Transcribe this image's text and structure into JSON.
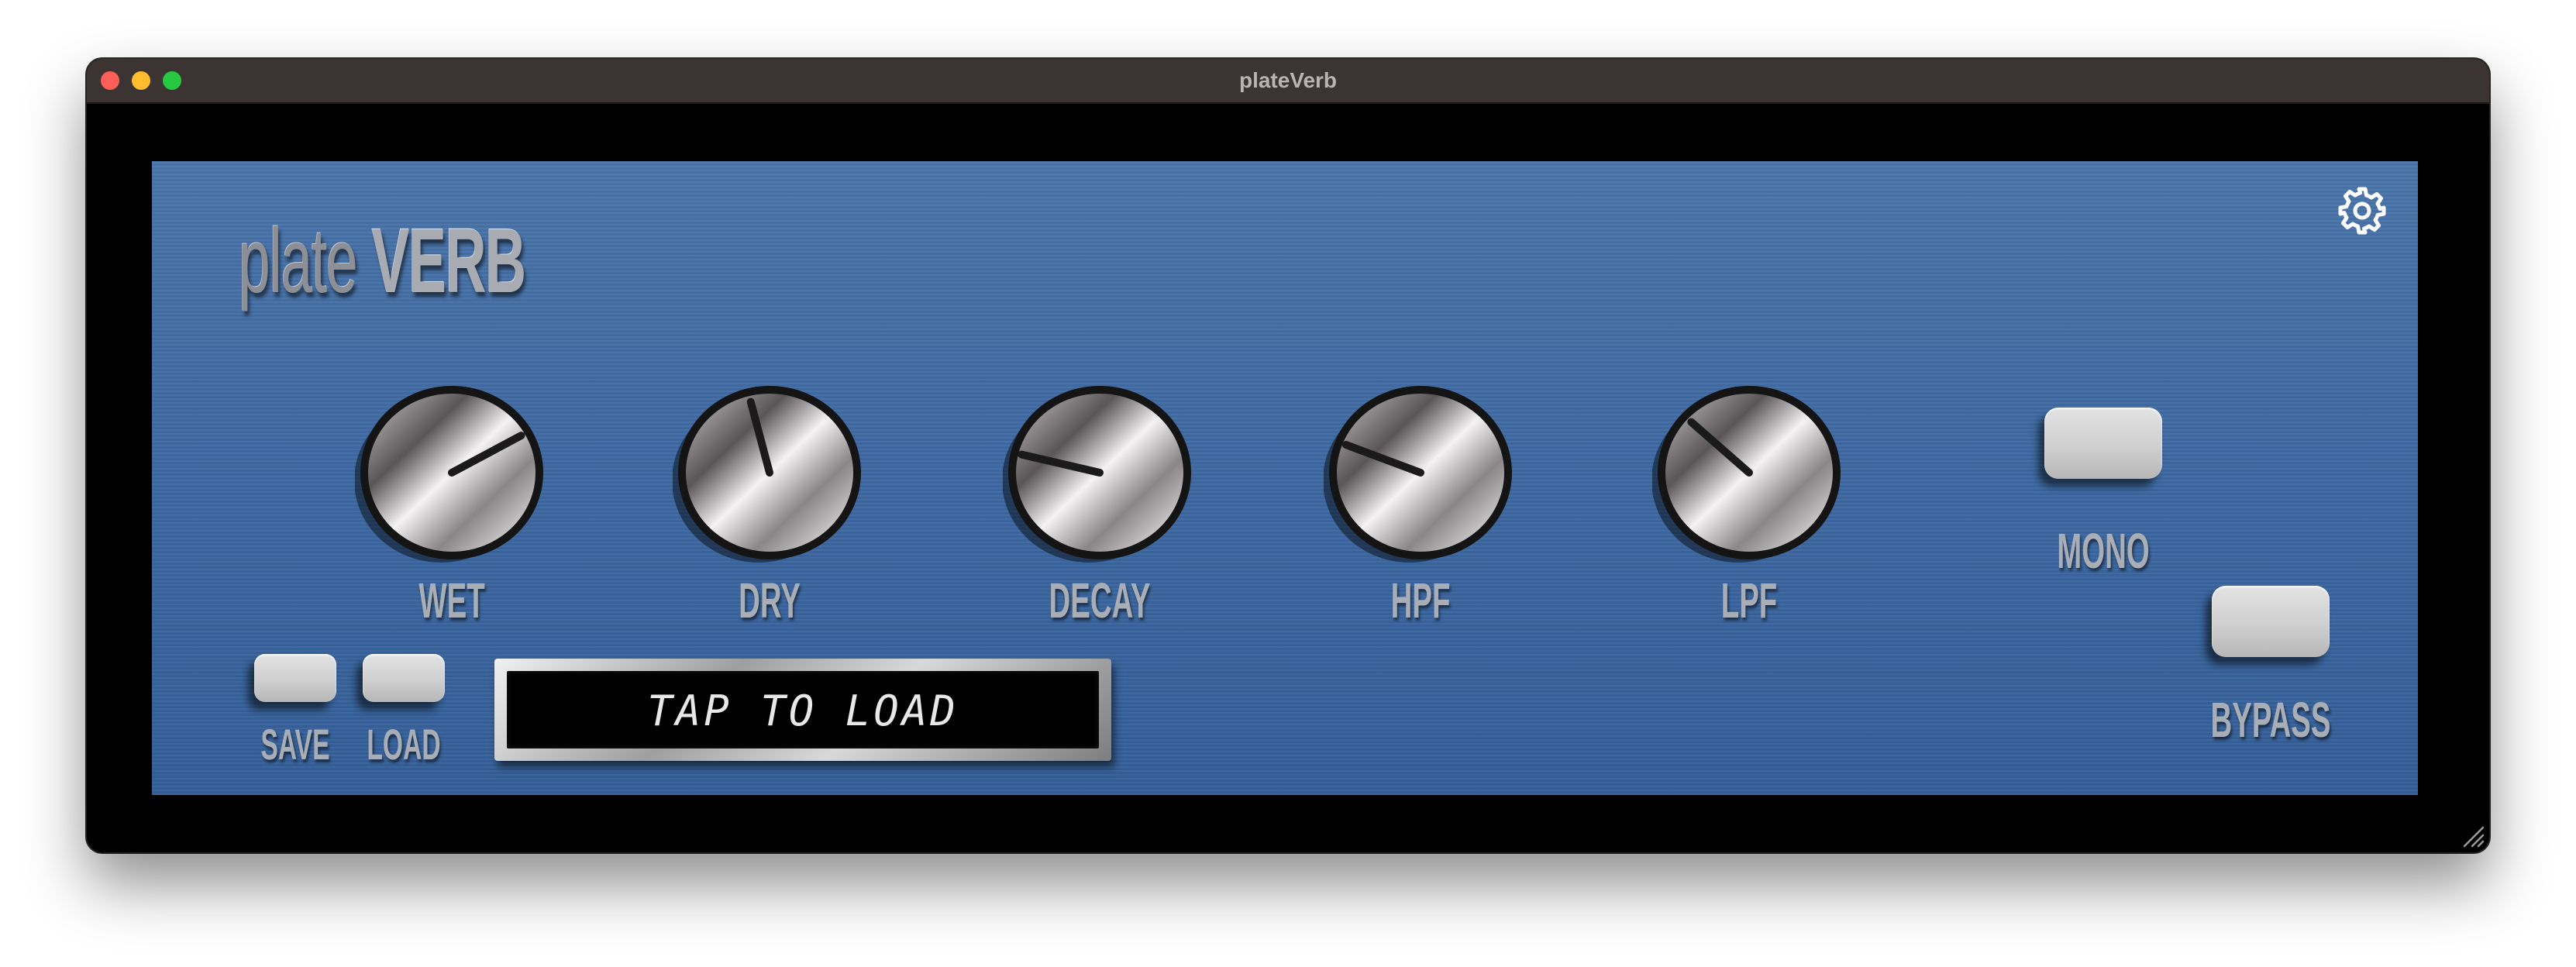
{
  "window": {
    "title": "plateVerb"
  },
  "logo": {
    "plate": "plate",
    "verb": "VERB"
  },
  "icons": {
    "settings": "gear-icon",
    "resize": "resize-grip-icon"
  },
  "knobs": [
    {
      "label": "WET",
      "value": 0.72
    },
    {
      "label": "DRY",
      "value": 0.45
    },
    {
      "label": "DECAY",
      "value": 0.22
    },
    {
      "label": "HPF",
      "value": 0.25
    },
    {
      "label": "LPF",
      "value": 0.33
    }
  ],
  "buttons": {
    "mono": "MONO",
    "bypass": "BYPASS",
    "save": "SAVE",
    "load": "LOAD"
  },
  "preset_display": {
    "text": "TAP TO LOAD"
  },
  "colors": {
    "panel": "#3d69a2",
    "titlebar": "#3b3433",
    "label": "#a8adb6"
  }
}
